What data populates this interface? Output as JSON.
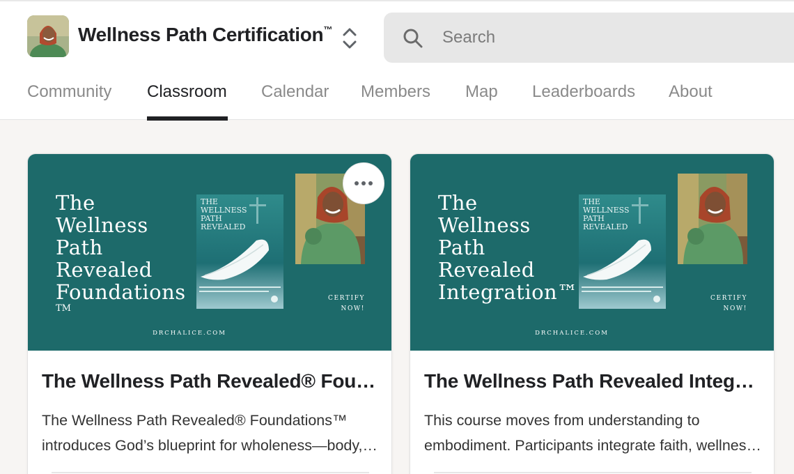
{
  "group": {
    "name": "Wellness Path Certification",
    "trademark": "™"
  },
  "search": {
    "placeholder": "Search"
  },
  "tabs": [
    {
      "label": "Community",
      "active": false
    },
    {
      "label": "Classroom",
      "active": true
    },
    {
      "label": "Calendar",
      "active": false
    },
    {
      "label": "Members",
      "active": false
    },
    {
      "label": "Map",
      "active": false
    },
    {
      "label": "Leaderboards",
      "active": false
    },
    {
      "label": "About",
      "active": false
    }
  ],
  "colors": {
    "banner": "#1d6a6a",
    "active_tab": "#202124",
    "inactive_tab": "#8a8a8a"
  },
  "courses": [
    {
      "banner_title": "The\nWellness\nPath\nRevealed\nFoundations",
      "banner_tm": "TM",
      "book_title": "THE\nWELLNESS\nPATH\nREVEALED",
      "book_subtitle": "God's Blueprint\nfor Wholeness\n– Body, Soul,\nand Spirit™",
      "certify": "CERTIFY\nNOW!",
      "website": "DRCHALICE.COM",
      "title": "The Wellness Path Revealed® Foundations™",
      "description_lines": [
        "The Wellness Path Revealed® Foundations™",
        "introduces God’s blueprint for wholeness—body, soul, and spirit."
      ],
      "has_menu": true
    },
    {
      "banner_title": "The\nWellness\nPath\nRevealed\nIntegration™",
      "banner_tm": "",
      "book_title": "THE\nWELLNESS\nPATH\nREVEALED",
      "book_subtitle": "God's Blueprint\nfor Wholeness\n– Body, Soul,\nand Spirit™",
      "certify": "CERTIFY\nNOW!",
      "website": "DRCHALICE.COM",
      "title": "The Wellness Path Revealed Integration™",
      "description_lines": [
        "This course moves from understanding to",
        "embodiment. Participants integrate faith, wellness, and practice."
      ],
      "has_menu": false
    }
  ]
}
